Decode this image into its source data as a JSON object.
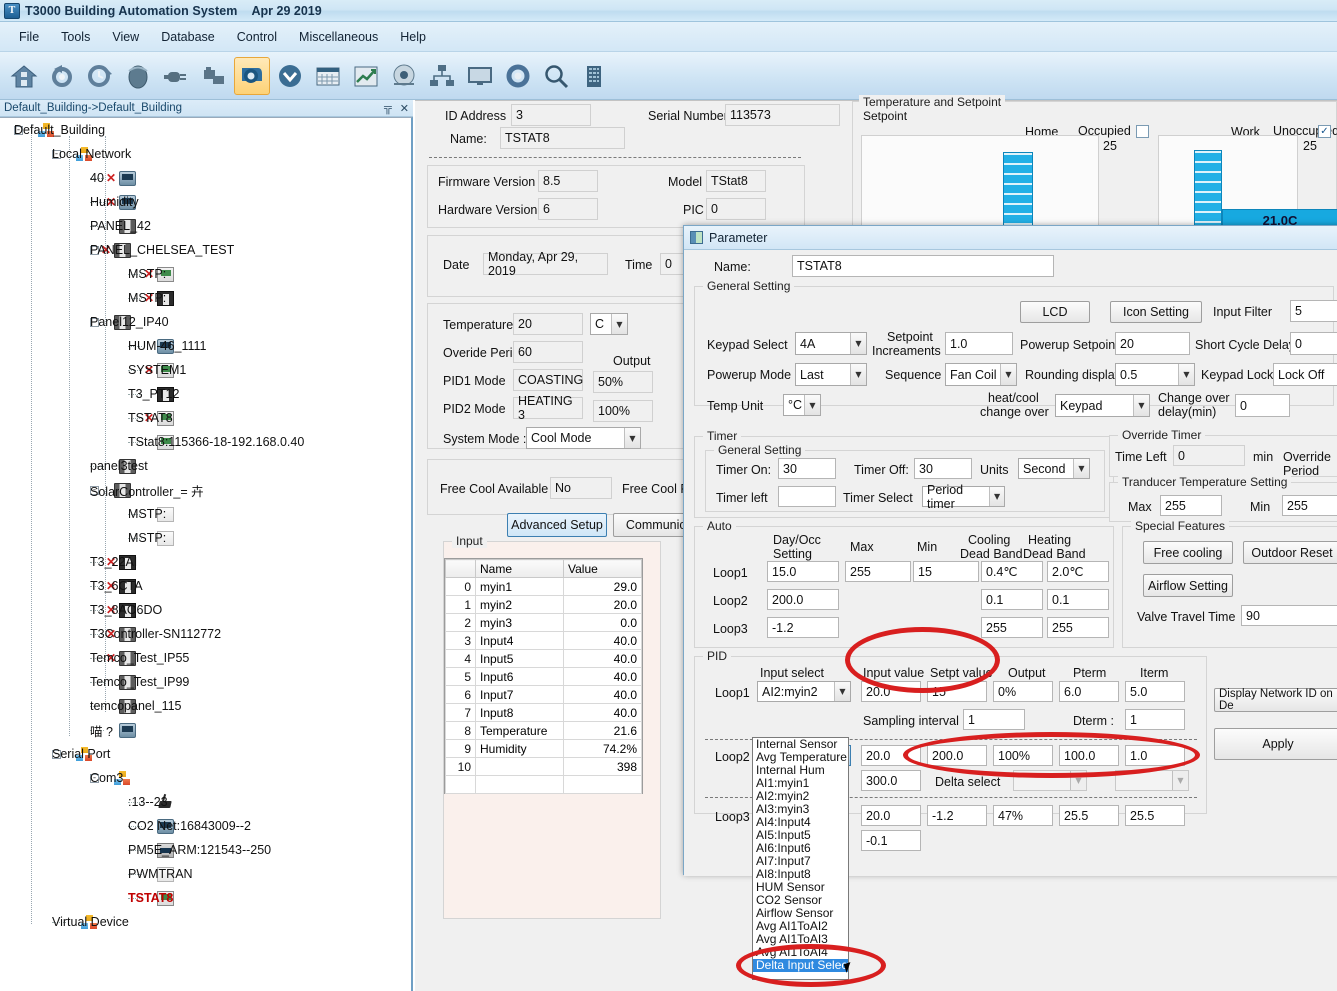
{
  "window": {
    "title": "T3000 Building Automation System",
    "date": "Apr 29 2019",
    "app_icon": "T"
  },
  "menubar": {
    "items": [
      "File",
      "Tools",
      "View",
      "Database",
      "Control",
      "Miscellaneous",
      "Help"
    ]
  },
  "toolbar": {
    "icons": [
      "home-icon",
      "refresh-gear-icon",
      "schedule-gear-icon",
      "mouse-icon",
      "plug-icon",
      "folder-link-icon",
      "blower-icon",
      "download-icon",
      "calendar-icon",
      "trend-chart-icon",
      "alarm-bell-icon",
      "network-icon",
      "monitor-icon",
      "settings-gear-icon",
      "search-icon",
      "building-icon"
    ],
    "active_index": 6
  },
  "tree_header": {
    "breadcrumb": "Default_Building->Default_Building",
    "pin": "╦",
    "close": "✕"
  },
  "tree": [
    {
      "depth": 0,
      "label": "Default_Building",
      "icon": "net",
      "exp": "-",
      "x": false
    },
    {
      "depth": 1,
      "label": "Local Network",
      "icon": "net",
      "exp": "-",
      "x": false
    },
    {
      "depth": 2,
      "label": "40",
      "icon": "dev",
      "exp": "",
      "x": true
    },
    {
      "depth": 2,
      "label": "Humidity",
      "icon": "dev",
      "exp": "",
      "x": true
    },
    {
      "depth": 2,
      "label": "PANEL_42",
      "icon": "panel",
      "exp": "",
      "x": false
    },
    {
      "depth": 2,
      "label": "PANEL_CHELSEA_TEST",
      "icon": "panel",
      "exp": "-",
      "x": true
    },
    {
      "depth": 3,
      "label": "MSTP:",
      "icon": "stat",
      "exp": "",
      "x": true
    },
    {
      "depth": 3,
      "label": "MSTP:",
      "icon": "panel-dk",
      "exp": "",
      "x": true
    },
    {
      "depth": 2,
      "label": "Panel12_IP40",
      "icon": "panel",
      "exp": "-",
      "x": false
    },
    {
      "depth": 3,
      "label": "HUM-46_1111",
      "icon": "dev",
      "exp": "",
      "x": false
    },
    {
      "depth": 3,
      "label": "SYSTEM1",
      "icon": "stat",
      "exp": "",
      "x": true
    },
    {
      "depth": 3,
      "label": "T3_PT12",
      "icon": "panel-dk",
      "exp": "",
      "x": false
    },
    {
      "depth": 3,
      "label": "TSTAT8",
      "icon": "stat",
      "exp": "",
      "x": true
    },
    {
      "depth": 3,
      "label": "TStat8:115366-18-192.168.0.40",
      "icon": "stat",
      "exp": "",
      "x": false
    },
    {
      "depth": 2,
      "label": "panel3test",
      "icon": "panel",
      "exp": "",
      "x": false
    },
    {
      "depth": 2,
      "label": "SolarController_= 卉",
      "icon": "panel",
      "exp": "-",
      "x": false
    },
    {
      "depth": 3,
      "label": "MSTP:",
      "icon": "blank",
      "exp": "",
      "x": false
    },
    {
      "depth": 3,
      "label": "MSTP:",
      "icon": "blank",
      "exp": "",
      "x": false
    },
    {
      "depth": 2,
      "label": "T3_22AI",
      "icon": "panel-dk",
      "exp": "",
      "x": true
    },
    {
      "depth": 2,
      "label": "T3_6CTA",
      "icon": "panel-dk",
      "exp": "",
      "x": true
    },
    {
      "depth": 2,
      "label": "T3_8AO6DO",
      "icon": "panel-dk",
      "exp": "",
      "x": true
    },
    {
      "depth": 2,
      "label": "T3Controller-SN112772",
      "icon": "panel",
      "exp": "",
      "x": true
    },
    {
      "depth": 2,
      "label": "Temco_Test_IP55",
      "icon": "panel",
      "exp": "",
      "x": true
    },
    {
      "depth": 2,
      "label": "Temco_Test_IP99",
      "icon": "panel",
      "exp": "",
      "x": false
    },
    {
      "depth": 2,
      "label": "temcopanel_115",
      "icon": "panel",
      "exp": "",
      "x": false
    },
    {
      "depth": 2,
      "label": "喵  ?",
      "icon": "dev",
      "exp": "",
      "x": false
    },
    {
      "depth": 1,
      "label": "Serial Port",
      "icon": "net",
      "exp": "-",
      "x": false
    },
    {
      "depth": 2,
      "label": "Com3",
      "icon": "net",
      "exp": "-",
      "x": false
    },
    {
      "depth": 3,
      "label": ":13--23",
      "icon": "ant",
      "exp": "",
      "x": false
    },
    {
      "depth": 3,
      "label": "CO2 Net:16843009--2",
      "icon": "dev",
      "exp": "",
      "x": false
    },
    {
      "depth": 3,
      "label": "PM5E_ARM:121543--250",
      "icon": "meter",
      "exp": "",
      "x": false
    },
    {
      "depth": 3,
      "label": "PWMTRAN",
      "icon": "blank",
      "exp": "",
      "x": false
    },
    {
      "depth": 3,
      "label": "TSTAT8",
      "icon": "stat",
      "exp": "",
      "x": false,
      "red": true
    },
    {
      "depth": 1,
      "label": "Virtual Device",
      "icon": "net",
      "exp": "",
      "x": false
    }
  ],
  "main": {
    "id_address_label": "ID Address",
    "id_address_value": "3",
    "serial_number_label": "Serial Number",
    "serial_number_value": "113573",
    "name_label": "Name:",
    "name_value": "TSTAT8",
    "firmware_label": "Firmware Version",
    "firmware_value": "8.5",
    "model_label": "Model",
    "model_value": "TStat8",
    "hardware_label": "Hardware Version",
    "hardware_value": "6",
    "pic_label": "PIC",
    "pic_value": "0",
    "date_label": "Date",
    "date_value": "Monday, Apr 29, 2019",
    "time_label": "Time",
    "time_value": "0",
    "temperature_label": "Temperature",
    "temperature_value": "20",
    "temp_unit_value": "C",
    "overide_period_label": "Overide Period",
    "overide_period_value": "60",
    "output_label": "Output",
    "pid1_mode_label": "PID1 Mode",
    "pid1_mode_value": "COASTING",
    "pid1_output_value": "50%",
    "pid2_mode_label": "PID2 Mode",
    "pid2_mode_value": "HEATING 3",
    "pid2_output_value": "100%",
    "system_mode_label": "System Mode :",
    "system_mode_value": "Cool Mode",
    "free_cool_available_label": "Free Cool Available",
    "free_cool_available_value": "No",
    "free_cool_feature_label": "Free Cool Fea",
    "advanced_setup_label": "Advanced Setup",
    "communication_label": "Communicat",
    "input_group_label": "Input"
  },
  "input_table": {
    "columns": [
      "",
      "Name",
      "Value"
    ],
    "rows": [
      [
        "0",
        "myin1",
        "29.0"
      ],
      [
        "1",
        "myin2",
        "20.0"
      ],
      [
        "2",
        "myin3",
        "0.0"
      ],
      [
        "3",
        "Input4",
        "40.0"
      ],
      [
        "4",
        "Input5",
        "40.0"
      ],
      [
        "5",
        "Input6",
        "40.0"
      ],
      [
        "6",
        "Input7",
        "40.0"
      ],
      [
        "7",
        "Input8",
        "40.0"
      ],
      [
        "8",
        "Temperature",
        "21.6"
      ],
      [
        "9",
        "Humidity",
        "74.2%"
      ],
      [
        "10",
        "",
        "398"
      ],
      [
        "",
        "",
        ""
      ]
    ]
  },
  "setpoint_panel": {
    "group_label": "Temperature and Setpoint",
    "sub_label": "Setpoint",
    "home_label": "Home",
    "work_label": "Work",
    "occupied_label": "Occupied",
    "occupied_checked": false,
    "unoccupied_label": "Unoccupied",
    "unoccupied_checked": true,
    "home_scale_top": "25",
    "work_scale_top": "25",
    "current_temp_label": "21.0C"
  },
  "dialog": {
    "title": "Parameter",
    "name_label": "Name:",
    "name_value": "TSTAT8",
    "general_setting_label": "General Setting",
    "lcd_button": "LCD",
    "icon_setting_button": "Icon Setting",
    "input_filter_label": "Input Filter",
    "input_filter_value": "5",
    "keypad_select_label": "Keypad Select",
    "keypad_select_value": "4A",
    "setpoint_increaments_label": "Setpoint\nIncreaments",
    "setpoint_increaments_line1": "Setpoint",
    "setpoint_increaments_line2": "Increaments",
    "setpoint_increaments_value": "1.0",
    "powerup_setpoint_label": "Powerup Setpoint",
    "powerup_setpoint_value": "20",
    "short_cycle_delay_label": "Short Cycle Delay",
    "short_cycle_delay_value": "0",
    "powerup_mode_label": "Powerup Mode",
    "powerup_mode_value": "Last",
    "sequence_label": "Sequence",
    "sequence_value": "Fan Coil",
    "rounding_display_label": "Rounding display",
    "rounding_display_value": "0.5",
    "keypad_lock_label": "Keypad Lock",
    "keypad_lock_value": "Lock Off",
    "temp_unit_label": "Temp Unit",
    "temp_unit_value": "°C",
    "heatcool_changeover_line1": "heat/cool",
    "heatcool_changeover_line2": "change over",
    "heatcool_changeover_value": "Keypad",
    "changeover_delay_line1": "Change over",
    "changeover_delay_line2": "delay(min)",
    "changeover_delay_value": "0",
    "timer_group_label": "Timer",
    "timer_general_label": "General Setting",
    "timer_on_label": "Timer On:",
    "timer_on_value": "30",
    "timer_off_label": "Timer Off:",
    "timer_off_value": "30",
    "units_label": "Units",
    "units_value": "Second",
    "timer_left_label": "Timer left",
    "timer_left_value": "",
    "timer_select_label": "Timer Select",
    "timer_select_value": "Period timer",
    "override_timer_label": "Override Timer",
    "time_left_label": "Time Left",
    "time_left_value": "0",
    "min_label": "min",
    "override_period_label": "Override Period",
    "tranducer_label": "Tranducer Temperature Setting",
    "tranducer_max_label": "Max",
    "tranducer_max_value": "255",
    "tranducer_min_label": "Min",
    "tranducer_min_value": "255",
    "auto_group_label": "Auto",
    "auto_headers": [
      "Day/Occ\nSetting",
      "Max",
      "Min",
      "Cooling\nDead Band",
      "Heating\nDead Band"
    ],
    "auto_h1a": "Day/Occ",
    "auto_h1b": "Setting",
    "auto_h2": "Max",
    "auto_h3": "Min",
    "auto_h4a": "Cooling",
    "auto_h4b": "Dead Band",
    "auto_h5a": "Heating",
    "auto_h5b": "Dead Band",
    "auto_rows": [
      {
        "name": "Loop1",
        "dayocc": "15.0",
        "max": "255",
        "min": "15",
        "cool_db": "0.4℃",
        "heat_db": "2.0℃"
      },
      {
        "name": "Loop2",
        "dayocc": "200.0",
        "max": "",
        "min": "",
        "cool_db": "0.1",
        "heat_db": "0.1"
      },
      {
        "name": "Loop3",
        "dayocc": "-1.2",
        "max": "",
        "min": "",
        "cool_db": "255",
        "heat_db": "255"
      }
    ],
    "special_features_label": "Special Features",
    "free_cooling_button": "Free cooling",
    "outdoor_reset_button": "Outdoor Reset",
    "airflow_setting_button": "Airflow Setting",
    "valve_travel_time_label": "Valve Travel Time",
    "valve_travel_time_value": "90",
    "pid_group_label": "PID",
    "pid_headers": [
      "Input select",
      "Input value",
      "Setpt value",
      "Output",
      "Pterm",
      "Iterm"
    ],
    "pid_h1": "Input select",
    "pid_h2": "Input value",
    "pid_h3": "Setpt value",
    "pid_h4": "Output",
    "pid_h5": "Pterm",
    "pid_h6": "Iterm",
    "loop1_label": "Loop1",
    "loop1_input_select": "AI2:myin2",
    "loop1_input_value": "20.0",
    "loop1_setpt_value": "15",
    "loop1_output": "0%",
    "loop1_pterm": "6.0",
    "loop1_iterm": "5.0",
    "sampling_interval_label": "Sampling interval :",
    "sampling_interval_value": "1",
    "dterm_label": "Dterm :",
    "dterm_value": "1",
    "loop2_label": "Loop2",
    "loop2_input_select": "AI1:myin1",
    "loop2_input_value": "20.0",
    "loop2_setpt_value": "200.0",
    "loop2_output": "100%",
    "loop2_pterm": "100.0",
    "loop2_iterm": "1.0",
    "loop2_extra_value": "300.0",
    "delta_select_label": "Delta select",
    "delta_select_1": "",
    "delta_select_2": "",
    "loop3_label": "Loop3",
    "loop3_input_value": "20.0",
    "loop3_setpt_value": "-1.2",
    "loop3_output": "47%",
    "loop3_pterm": "25.5",
    "loop3_iterm": "25.5",
    "loop3_extra_value": "-0.1",
    "display_network_id_button": "Display Network ID on De",
    "apply_button": "Apply"
  },
  "dropdown": {
    "selected_value": "AI1:myin1",
    "items": [
      "Internal Sensor",
      "Avg Temperature",
      "Internal Hum",
      "AI1:myin1",
      "AI2:myin2",
      "AI3:myin3",
      "AI4:Input4",
      "AI5:Input5",
      "AI6:Input6",
      "AI7:Input7",
      "AI8:Input8",
      "HUM Sensor",
      "CO2 Sensor",
      "Airflow Sensor",
      "Avg AI1ToAI2",
      "Avg AI1ToAI3",
      "Avg AI1ToAI4",
      "Delta Input Select"
    ],
    "selected_index": 17
  },
  "colors": {
    "accent": "#2f8ae0",
    "annotation": "#d81f1f",
    "bar": "#17a9e0",
    "tree_selected": "#c00000",
    "toolbar_active": "#fdd277"
  }
}
